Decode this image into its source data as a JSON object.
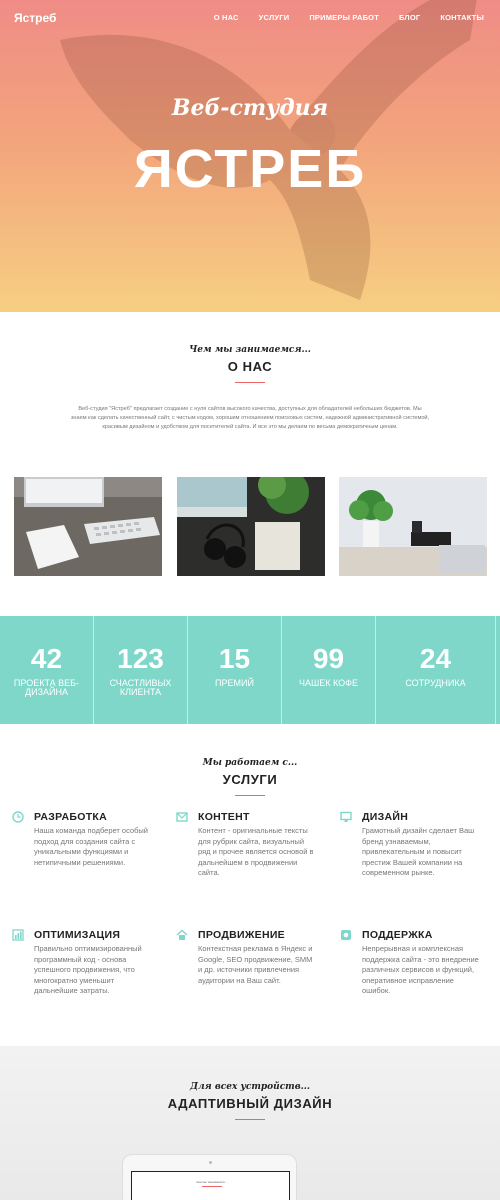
{
  "nav": {
    "logo": "Ястреб",
    "menu": [
      "О НАС",
      "УСЛУГИ",
      "ПРИМЕРЫ РАБОТ",
      "БЛОГ",
      "КОНТАКТЫ"
    ]
  },
  "hero": {
    "subtitle": "Веб-студия",
    "title": "ЯСТРЕБ"
  },
  "about": {
    "script": "Чем мы занимаемся...",
    "heading": "О НАС",
    "text": "Веб-студия \"Ястреб\" предлагает создание с нуля сайтов высокого качества, доступных для обладателей небольших бюджетов. Мы знаем как сделать качественный сайт, с чистым кодом, хорошим отношением поисковых систем, надежной административной системой, красивым дизайном и удобством для посетителей сайта. И все это мы делаем по весьма демократичным ценам."
  },
  "stats": [
    {
      "num": "42",
      "label": "ПРОЕКТА ВЕБ-ДИЗАЙНА"
    },
    {
      "num": "123",
      "label": "СЧАСТЛИВЫХ КЛИЕНТА"
    },
    {
      "num": "15",
      "label": "ПРЕМИЙ"
    },
    {
      "num": "99",
      "label": "ЧАШЕК КОФЕ"
    },
    {
      "num": "24",
      "label": "СОТРУДНИКА"
    }
  ],
  "services": {
    "script": "Мы работаем с...",
    "heading": "УСЛУГИ",
    "items": [
      {
        "title": "РАЗРАБОТКА",
        "icon": "clock-icon",
        "text": "Наша команда подберет особый подход для создания сайта с уникальными функциями и нетипичными решениями."
      },
      {
        "title": "КОНТЕНТ",
        "icon": "mail-icon",
        "text": "Контент - оригинальные тексты для рубрик сайта, визуальный ряд и прочее является основой в дальнейшем в продвижении сайта."
      },
      {
        "title": "ДИЗАЙН",
        "icon": "monitor-icon",
        "text": "Грамотный дизайн сделает Ваш бренд узнаваемым, привлекательным и повысит престиж Вашей компании на современном рынке."
      },
      {
        "title": "ОПТИМИЗАЦИЯ",
        "icon": "chart-icon",
        "text": "Правильно оптимизированный программный код - основа успешного продвижения, что многократно уменьшит дальнейшие затраты."
      },
      {
        "title": "ПРОДВИЖЕНИЕ",
        "icon": "home-icon",
        "text": "Контекстная реклама в Яндекс и Google, SEO продвижение, SMM и др. источники привлечения аудитории на Ваш сайт."
      },
      {
        "title": "ПОДДЕРЖКА",
        "icon": "gear-icon",
        "text": "Непрерывная и комплексная поддержка сайта - это внедрение различных сервисов и функций, оперативное исправление ошибок."
      }
    ]
  },
  "responsive": {
    "script": "Для всех устройств...",
    "heading": "АДАПТИВНЫЙ ДИЗАЙН",
    "screen_text": "Чем мы занимаемся..."
  },
  "colors": {
    "accent": "#e66666",
    "teal": "#7fd7c9",
    "hero_top": "#ef8c86",
    "hero_bottom": "#f6cf82"
  }
}
